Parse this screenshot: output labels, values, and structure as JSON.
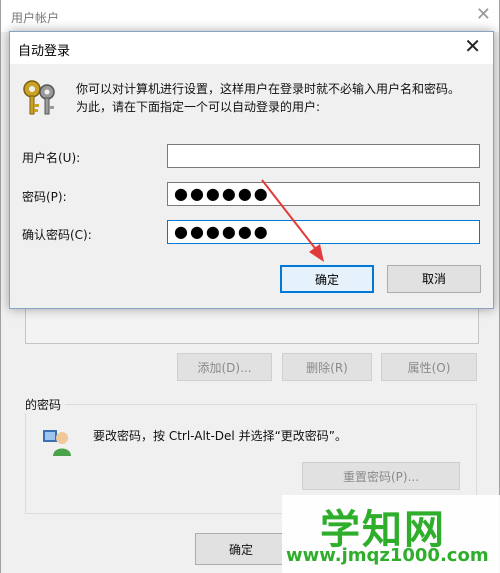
{
  "background_window": {
    "title": "用户帐户",
    "close_glyph": "✕",
    "buttons": {
      "add": "添加(D)...",
      "remove": "删除(R)",
      "properties": "属性(O)"
    },
    "password_group": {
      "title": "的密码",
      "text": "要改密码，按 Ctrl-Alt-Del 并选择“更改密码”。",
      "reset_button": "重置密码(P)...",
      "icon": "user-icon"
    },
    "ok_button": "确定"
  },
  "dialog": {
    "title": "自动登录",
    "close_glyph": "✕",
    "icon": "keys-icon",
    "description_line1": "你可以对计算机进行设置，这样用户在登录时就不必输入用户名和密码。",
    "description_line2": "为此，请在下面指定一个可以自动登录的用户:",
    "username_label": "用户名(U):",
    "username_value": "",
    "password_label": "密码(P):",
    "password_value": "●●●●●●",
    "confirm_label": "确认密码(C):",
    "confirm_value": "●●●●●●",
    "ok_button": "确定",
    "cancel_button": "取消"
  },
  "annotation": {
    "arrow_color": "#e23b3b"
  },
  "watermark": {
    "main": "学知网",
    "url": "www.jmqz1000.com",
    "color": "#2fae2c"
  }
}
